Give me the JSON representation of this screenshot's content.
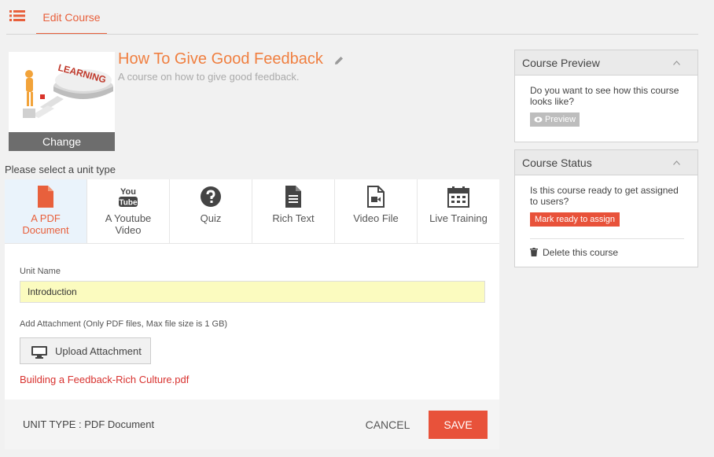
{
  "header": {
    "tab_label": "Edit Course"
  },
  "course": {
    "title": "How To Give Good Feedback",
    "subtitle": "A course on how to give good feedback.",
    "thumbnail_text": "LEARNING",
    "change_label": "Change"
  },
  "unit_select": {
    "label": "Please select a unit type",
    "types": [
      {
        "label_line1": "A PDF",
        "label_line2": "Document",
        "icon": "pdf-icon",
        "active": true
      },
      {
        "label_line1": "A Youtube",
        "label_line2": "Video",
        "icon": "youtube-icon",
        "active": false
      },
      {
        "label_line1": "Quiz",
        "label_line2": "",
        "icon": "question-icon",
        "active": false
      },
      {
        "label_line1": "Rich Text",
        "label_line2": "",
        "icon": "document-icon",
        "active": false
      },
      {
        "label_line1": "Video File",
        "label_line2": "",
        "icon": "video-file-icon",
        "active": false
      },
      {
        "label_line1": "Live Training",
        "label_line2": "",
        "icon": "calendar-icon",
        "active": false
      }
    ],
    "youtube_icon_top": "You",
    "youtube_icon_bottom": "Tube"
  },
  "unit_form": {
    "unit_name_label": "Unit Name",
    "unit_name_value": "Introduction",
    "attachment_label": "Add Attachment (Only PDF files, Max file size is 1 GB)",
    "upload_label": "Upload Attachment",
    "file_name": "Building a Feedback-Rich Culture.pdf"
  },
  "unit_footer": {
    "unit_type_text": "UNIT TYPE : PDF Document",
    "cancel_label": "CANCEL",
    "save_label": "SAVE"
  },
  "preview_panel": {
    "title": "Course Preview",
    "text": "Do you want to see how this course looks like?",
    "button_label": "Preview"
  },
  "status_panel": {
    "title": "Course Status",
    "text": "Is this course ready to get assigned to users?",
    "ready_label": "Mark ready to assign",
    "delete_label": "Delete this course"
  },
  "colors": {
    "accent": "#e8603c",
    "save": "#e8523a",
    "link_red": "#d8322f",
    "title_orange": "#f07f40"
  }
}
